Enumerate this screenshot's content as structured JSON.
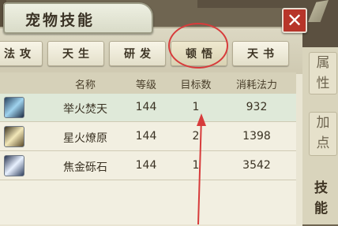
{
  "window": {
    "title": "宠物技能"
  },
  "tabs": [
    {
      "label": "法攻"
    },
    {
      "label": "天生"
    },
    {
      "label": "研发"
    },
    {
      "label": "顿悟"
    },
    {
      "label": "天书"
    }
  ],
  "table": {
    "headers": [
      "名称",
      "等级",
      "目标数",
      "消耗法力"
    ],
    "rows": [
      {
        "name": "举火焚天",
        "level": "144",
        "targets": "1",
        "mana": "932",
        "icon": "flame-skill-icon",
        "selected": true
      },
      {
        "name": "星火燎原",
        "level": "144",
        "targets": "2",
        "mana": "1398",
        "icon": "spark-skill-icon"
      },
      {
        "name": "焦金砾石",
        "level": "144",
        "targets": "1",
        "mana": "3542",
        "icon": "metal-skill-icon"
      }
    ]
  },
  "side": {
    "attr_label": "属性",
    "add_points_label": "加点",
    "skills_label": "技能"
  },
  "colors": {
    "accent_red": "#d73b3b",
    "close_red": "#b7352a",
    "selected_row": "#dfe9d9"
  }
}
